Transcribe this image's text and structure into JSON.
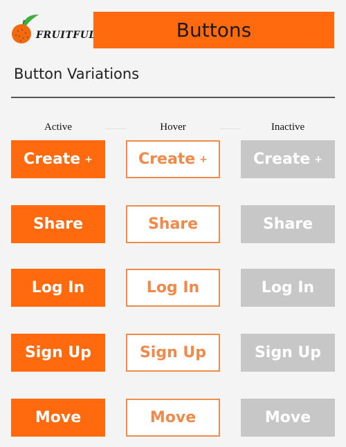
{
  "header": {
    "logo_text": "Fruitful",
    "title": "Buttons"
  },
  "section": {
    "title": "Button Variations"
  },
  "columns": [
    "Active",
    "Hover",
    "Inactive"
  ],
  "buttons": {
    "create": {
      "label": "Create",
      "suffix": "+"
    },
    "share": {
      "label": "Share"
    },
    "login": {
      "label": "Log In"
    },
    "signup": {
      "label": "Sign Up"
    },
    "move": {
      "label": "Move"
    }
  },
  "colors": {
    "brand": "#ff6a0e",
    "hover_text": "#ef8a4a",
    "inactive": "#c7c7c7"
  },
  "icons": {
    "logo": "orange-fruit-icon"
  }
}
